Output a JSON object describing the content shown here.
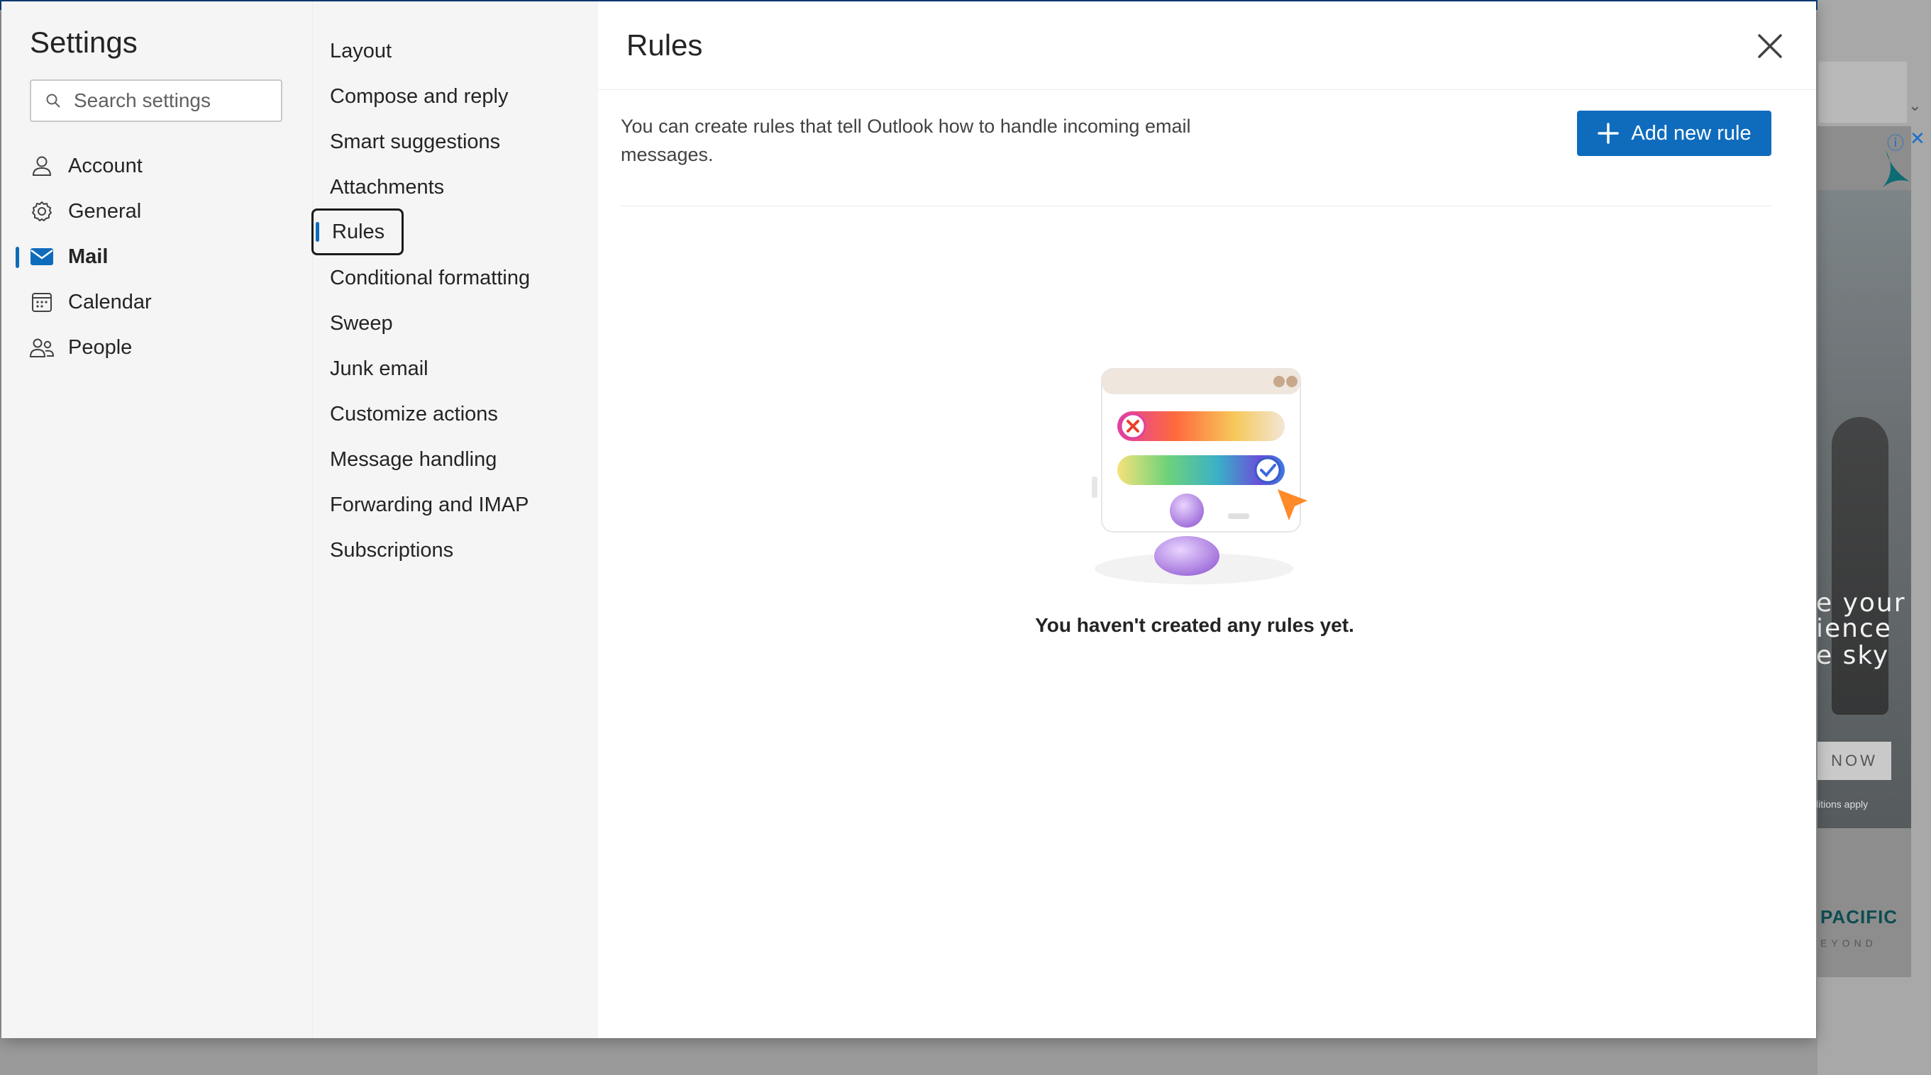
{
  "settings": {
    "title": "Settings",
    "search_placeholder": "Search settings"
  },
  "categories": [
    {
      "label": "Account",
      "icon": "person-icon",
      "active": false
    },
    {
      "label": "General",
      "icon": "gear-icon",
      "active": false
    },
    {
      "label": "Mail",
      "icon": "mail-icon",
      "active": true
    },
    {
      "label": "Calendar",
      "icon": "calendar-icon",
      "active": false
    },
    {
      "label": "People",
      "icon": "people-icon",
      "active": false
    }
  ],
  "mail_sections": [
    "Layout",
    "Compose and reply",
    "Smart suggestions",
    "Attachments",
    "Rules",
    "Conditional formatting",
    "Sweep",
    "Junk email",
    "Customize actions",
    "Message handling",
    "Forwarding and IMAP",
    "Subscriptions"
  ],
  "active_section": "Rules",
  "rules": {
    "title": "Rules",
    "description": "You can create rules that tell Outlook how to handle incoming email messages.",
    "add_button": "Add new rule",
    "empty_message": "You haven't created any rules yet."
  },
  "ad": {
    "line1": "e your",
    "line2": "ience",
    "line3": "e sky",
    "cta": "NOW",
    "small": "litions apply",
    "brand": "PACIFIC",
    "brand_tag": "EYOND"
  },
  "colors": {
    "accent": "#0f6cbd",
    "nav_bg": "#f5f5f5",
    "text": "#242424"
  }
}
